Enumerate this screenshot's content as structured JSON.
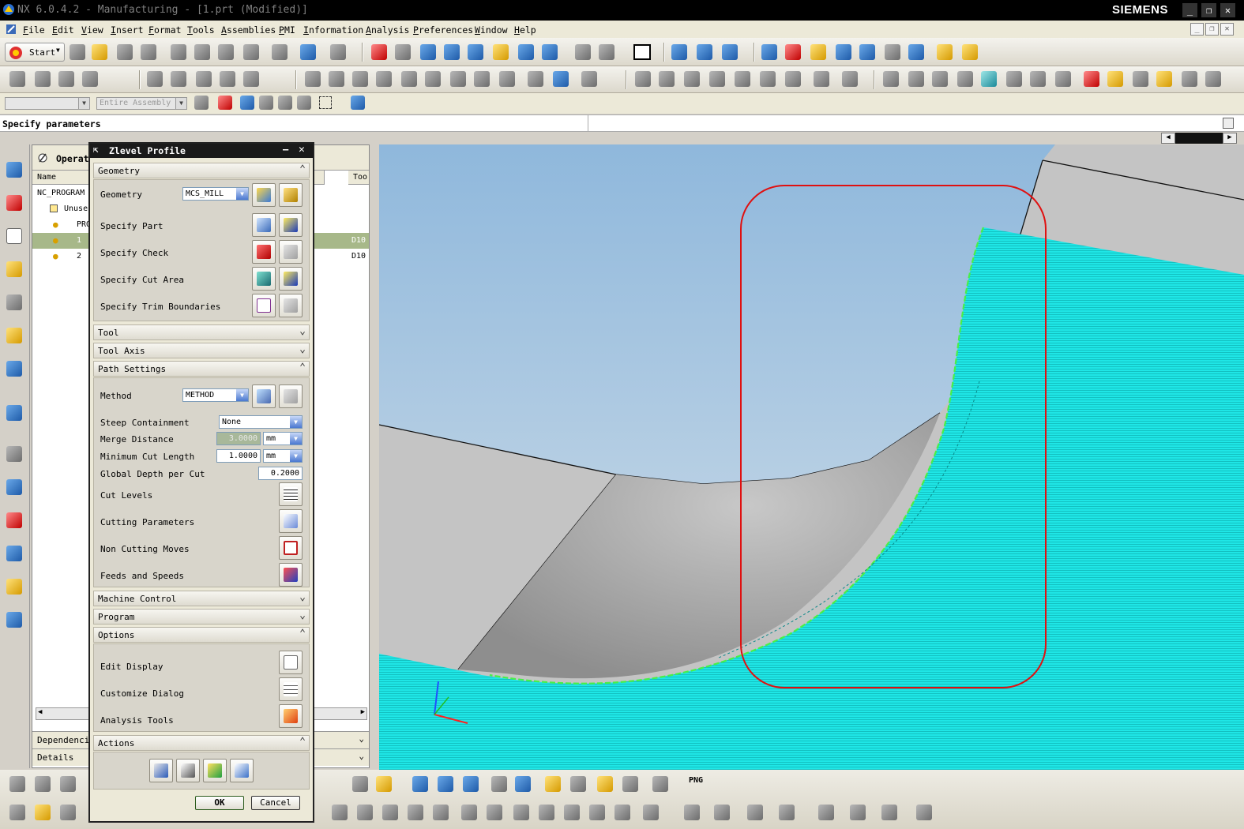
{
  "window": {
    "title": "NX 6.0.4.2 - Manufacturing - [1.prt (Modified)]",
    "brand": "SIEMENS"
  },
  "menu": [
    "File",
    "Edit",
    "View",
    "Insert",
    "Format",
    "Tools",
    "Assemblies",
    "PMI",
    "Information",
    "Analysis",
    "Preferences",
    "Window",
    "Help"
  ],
  "toolbar": {
    "start_label": "Start",
    "png_label": "PNG"
  },
  "selection": {
    "filter": "",
    "scope": "Entire Assembly"
  },
  "cue": {
    "text": "Specify parameters"
  },
  "navigator": {
    "tab": "Operat",
    "columns": {
      "name": "Name",
      "tool": "Too"
    },
    "rows": [
      {
        "name": "NC_PROGRAM",
        "tool": ""
      },
      {
        "name": "Unuse",
        "tool": ""
      },
      {
        "name": "PRO",
        "tool": ""
      },
      {
        "name": "1",
        "tool": "D10"
      },
      {
        "name": "2",
        "tool": "D10"
      }
    ],
    "sections": [
      "Dependenci",
      "Details"
    ]
  },
  "dialog": {
    "title": "Zlevel Profile",
    "sections": {
      "geometry": "Geometry",
      "tool": "Tool",
      "tool_axis": "Tool Axis",
      "path_settings": "Path Settings",
      "machine_control": "Machine Control",
      "program": "Program",
      "options": "Options",
      "actions": "Actions"
    },
    "geometry": {
      "label": "Geometry",
      "value": "MCS_MILL",
      "specify_part": "Specify Part",
      "specify_check": "Specify Check",
      "specify_cut_area": "Specify Cut Area",
      "specify_trim": "Specify Trim Boundaries"
    },
    "path": {
      "method_label": "Method",
      "method_value": "METHOD",
      "steep_label": "Steep Containment",
      "steep_value": "None",
      "merge_label": "Merge Distance",
      "merge_value": "3.0000",
      "merge_unit": "mm",
      "mincut_label": "Minimum Cut Length",
      "mincut_value": "1.0000",
      "mincut_unit": "mm",
      "depth_label": "Global Depth per Cut",
      "depth_value": "0.2000",
      "cut_levels": "Cut Levels",
      "cutting_params": "Cutting Parameters",
      "non_cutting": "Non Cutting Moves",
      "feeds": "Feeds and Speeds"
    },
    "options": {
      "edit_display": "Edit Display",
      "customize": "Customize Dialog",
      "analysis": "Analysis Tools"
    },
    "ok": "OK",
    "cancel": "Cancel"
  },
  "colors": {
    "toolpath": "#1fe6e6",
    "highlight": "#e01010",
    "sky_top": "#8fb8dc",
    "sky_bottom": "#d8e2ea"
  }
}
